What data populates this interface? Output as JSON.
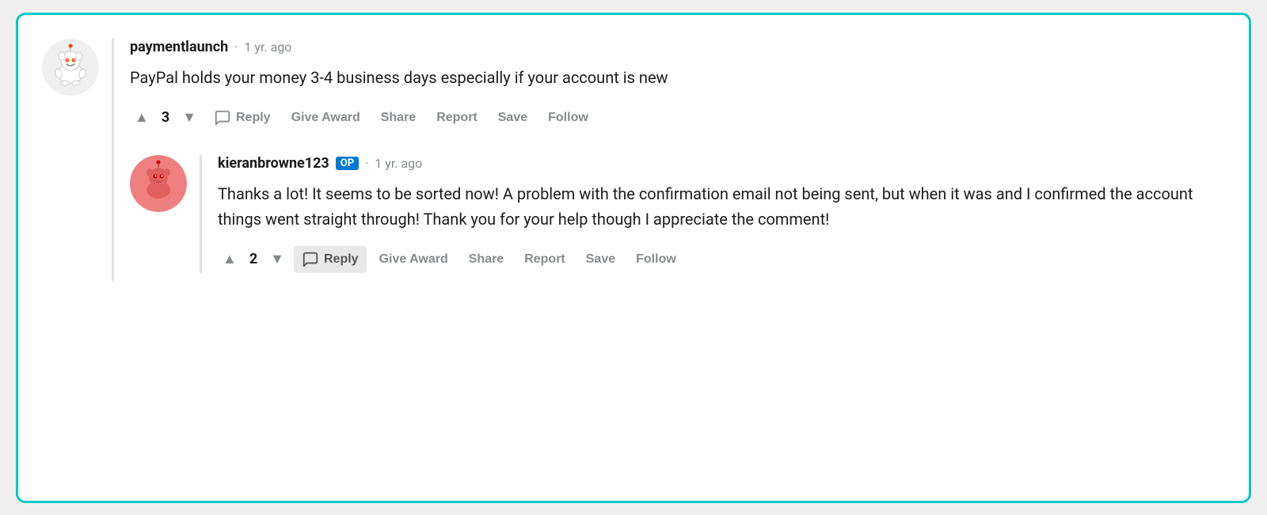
{
  "comment1": {
    "username": "paymentlaunch",
    "timestamp": "1 yr. ago",
    "text": "PayPal holds your money 3-4 business days especially if your account is new",
    "vote_count": "3",
    "actions": {
      "reply": "Reply",
      "give_award": "Give Award",
      "share": "Share",
      "report": "Report",
      "save": "Save",
      "follow": "Follow"
    }
  },
  "comment2": {
    "username": "kieranbrowne123",
    "op_badge": "OP",
    "timestamp": "1 yr. ago",
    "text": "Thanks a lot! It seems to be sorted now! A problem with the confirmation email not being sent, but when it was and I confirmed the account things went straight through! Thank you for your help though I appreciate the comment!",
    "vote_count": "2",
    "actions": {
      "reply": "Reply",
      "give_award": "Give Award",
      "share": "Share",
      "report": "Report",
      "save": "Save",
      "follow": "Follow"
    }
  },
  "icons": {
    "upvote": "▲",
    "downvote": "▼"
  }
}
